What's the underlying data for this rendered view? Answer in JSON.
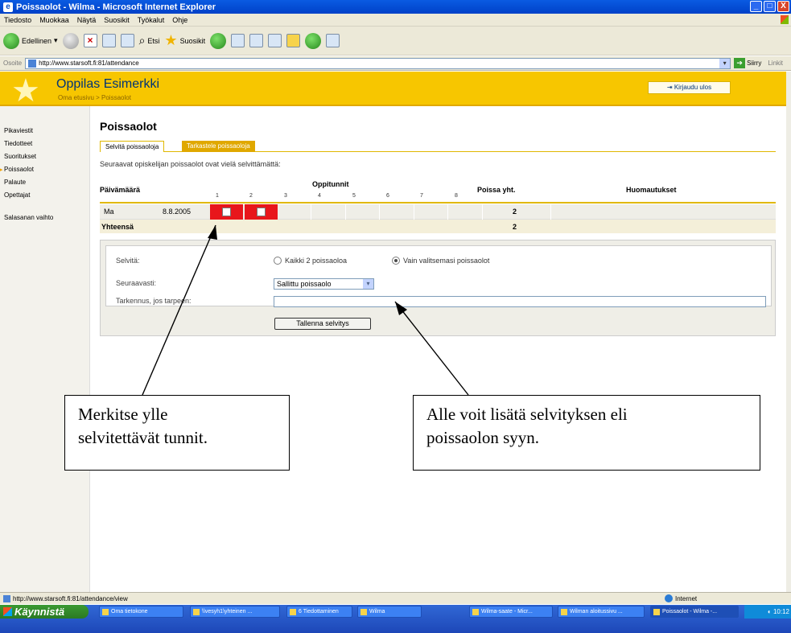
{
  "window": {
    "title": "Poissaolot - Wilma - Microsoft Internet Explorer",
    "buttons": [
      "_",
      "□",
      "X"
    ]
  },
  "menu": [
    "Tiedosto",
    "Muokkaa",
    "Näytä",
    "Suosikit",
    "Työkalut",
    "Ohje"
  ],
  "toolbar": {
    "back": "Edellinen",
    "search": "Etsi",
    "favorites": "Suosikit"
  },
  "address": {
    "label": "Osoite",
    "url": "http://www.starsoft.fi:81/attendance",
    "go": "Siirry",
    "links": "Linkit"
  },
  "header": {
    "name": "Oppilas Esimerkki",
    "breadcrumb": "Oma etusivu > Poissaolot",
    "logout": "Kirjaudu ulos"
  },
  "sidebar": {
    "items": [
      "Pikaviestit",
      "Tiedotteet",
      "Suoritukset",
      "Poissaolot",
      "Palaute",
      "Opettajat",
      "Salasanan vaihto"
    ],
    "active": "Poissaolot"
  },
  "page": {
    "title": "Poissaolot",
    "tabs": [
      "Selvitä poissaoloja",
      "Tarkastele poissaoloja"
    ],
    "intro": "Seuraavat opiskelijan poissaolot ovat vielä selvittämättä:"
  },
  "table": {
    "headers": {
      "date": "Päivämäärä",
      "lessons": "Oppitunnit",
      "total": "Poissa yht.",
      "notes": "Huomautukset"
    },
    "lesson_numbers": [
      "1",
      "2",
      "3",
      "4",
      "5",
      "6",
      "7",
      "8"
    ],
    "row": {
      "day": "Ma",
      "date": "8.8.2005",
      "absent_lessons": [
        1,
        2
      ],
      "total": "2"
    },
    "sum_row": {
      "label": "Yhteensä",
      "total": "2"
    }
  },
  "form": {
    "explain_label": "Selvitä:",
    "radio_all": "Kaikki 2 poissaoloa",
    "radio_selected": "Vain valitsemasi poissaolot",
    "selected_radio": "Vain valitsemasi poissaolot",
    "followup_label": "Seuraavasti:",
    "followup_value": "Sallittu poissaolo",
    "detail_label": "Tarkennus, jos tarpeen:",
    "detail_value": "",
    "save": "Tallenna selvitys"
  },
  "callouts": {
    "left": [
      "Merkitse ylle",
      "selvitettävät tunnit."
    ],
    "right": [
      "Alle voit lisätä selvityksen eli",
      "poissaolon syyn."
    ]
  },
  "status": {
    "url": "http://www.starsoft.fi:81/attendance/view",
    "zone": "Internet"
  },
  "taskbar": {
    "start": "Käynnistä",
    "tasks": [
      "Oma tietokone",
      "\\\\vesyh1\\yhteinen ...",
      "6 Tiedottaminen",
      "Wilma",
      "Wilma-saate - Micr...",
      "Wilman aloitussivu ...",
      "Poissaolot - Wilma -..."
    ],
    "clock": "10:12"
  },
  "colors": {
    "accent": "#f7c600",
    "absent": "#e8161b",
    "titlebar": "#0a5be2",
    "link": "#003477"
  }
}
